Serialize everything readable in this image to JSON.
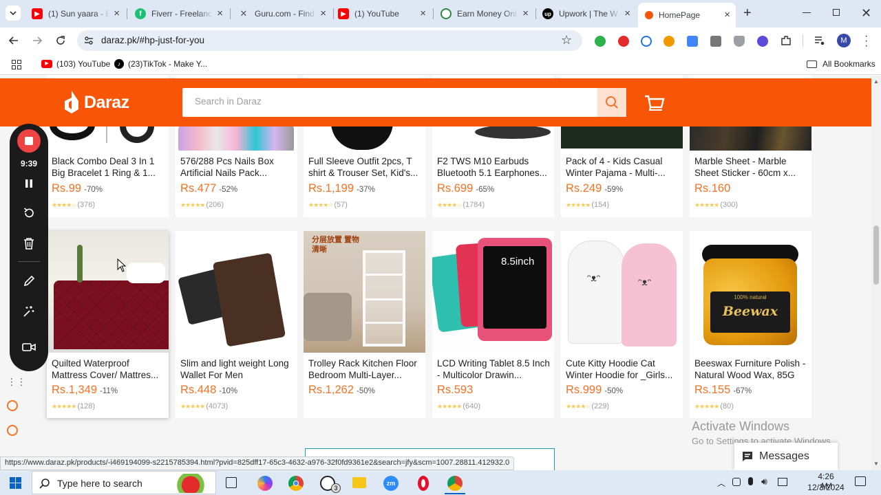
{
  "browser": {
    "tabs": [
      {
        "title": "(1) Sun yaara - E",
        "active": false
      },
      {
        "title": "Fiverr - Freelanc",
        "active": false
      },
      {
        "title": "Guru.com - Find",
        "active": false
      },
      {
        "title": "(1) YouTube",
        "active": false
      },
      {
        "title": "Earn Money Onl",
        "active": false
      },
      {
        "title": "Upwork | The W",
        "active": false
      },
      {
        "title": "HomePage",
        "active": true
      }
    ],
    "new_tab": "+",
    "url": "daraz.pk/#hp-just-for-you",
    "bookmarks": [
      "(103) YouTube",
      "(23)TikTok - Make Y..."
    ],
    "all_bookmarks": "All Bookmarks",
    "profile_initial": "M",
    "status_url": "https://www.daraz.pk/products/-i469194099-s2215785394.html?pvid=825dff17-65c3-4632-a976-32f0fd9361e2&search=jfy&scm=1007.28811.412932.0"
  },
  "daraz": {
    "logo": "Daraz",
    "search_placeholder": "Search in Daraz",
    "brand_color": "#f85606"
  },
  "products_row1": [
    {
      "title": "Black Combo Deal 3 In 1 Big Bracelet 1 Ring & 1...",
      "price": "Rs.99",
      "discount": "-70%",
      "stars": "★★★★☆",
      "reviews": "(376)"
    },
    {
      "title": "576/288 Pcs Nails Box Artificial Nails Pack...",
      "price": "Rs.477",
      "discount": "-52%",
      "stars": "★★★★★",
      "reviews": "(206)"
    },
    {
      "title": "Full Sleeve Outfit 2pcs, T shirt & Trouser Set, Kid's...",
      "price": "Rs.1,199",
      "discount": "-37%",
      "stars": "★★★★☆",
      "reviews": "(57)"
    },
    {
      "title": "F2 TWS M10 Earbuds Bluetooth 5.1 Earphones...",
      "price": "Rs.699",
      "discount": "-65%",
      "stars": "★★★★☆",
      "reviews": "(1784)"
    },
    {
      "title": "Pack of 4 - Kids Casual Winter Pajama - Multi-...",
      "price": "Rs.249",
      "discount": "-59%",
      "stars": "★★★★★",
      "reviews": "(154)"
    },
    {
      "title": "Marble Sheet - Marble Sheet Sticker - 60cm x...",
      "price": "Rs.160",
      "discount": "",
      "stars": "★★★★★",
      "reviews": "(300)"
    }
  ],
  "products_row2": [
    {
      "title": "Quilted Waterproof Mattress Cover/ Mattres...",
      "price": "Rs.1,349",
      "discount": "-11%",
      "stars": "★★★★★",
      "reviews": "(128)"
    },
    {
      "title": "Slim and light weight Long Wallet For Men",
      "price": "Rs.448",
      "discount": "-10%",
      "stars": "★★★★★",
      "reviews": "(4073)"
    },
    {
      "title": "Trolley Rack Kitchen Floor Bedroom Multi-Layer...",
      "price": "Rs.1,262",
      "discount": "-50%",
      "stars": "",
      "reviews": ""
    },
    {
      "title": "LCD Writing Tablet 8.5 Inch - Multicolor Drawin...",
      "price": "Rs.593",
      "discount": "",
      "stars": "★★★★★",
      "reviews": "(640)"
    },
    {
      "title": "Cute Kitty Hoodie Cat Winter Hoodie for _Girls...",
      "price": "Rs.999",
      "discount": "-50%",
      "stars": "★★★★☆",
      "reviews": "(229)"
    },
    {
      "title": "Beeswax Furniture Polish - Natural Wood Wax, 85G",
      "price": "Rs.155",
      "discount": "-67%",
      "stars": "★★★★★",
      "reviews": "(80)"
    }
  ],
  "image_text": {
    "rack_chinese": "分层放置 置物清晰",
    "tablet_label": "8.5inch",
    "beewax_natural": "100% natural",
    "beewax_label": "Beewax"
  },
  "recorder": {
    "timer": "9:39"
  },
  "watermark": {
    "title": "Activate Windows",
    "subtitle": "Go to Settings to activate Windows."
  },
  "messages_label": "Messages",
  "taskbar": {
    "search_placeholder": "Type here to search",
    "time": "4:26 AM",
    "date": "12/3/2024",
    "whatsapp_badge": "3"
  }
}
